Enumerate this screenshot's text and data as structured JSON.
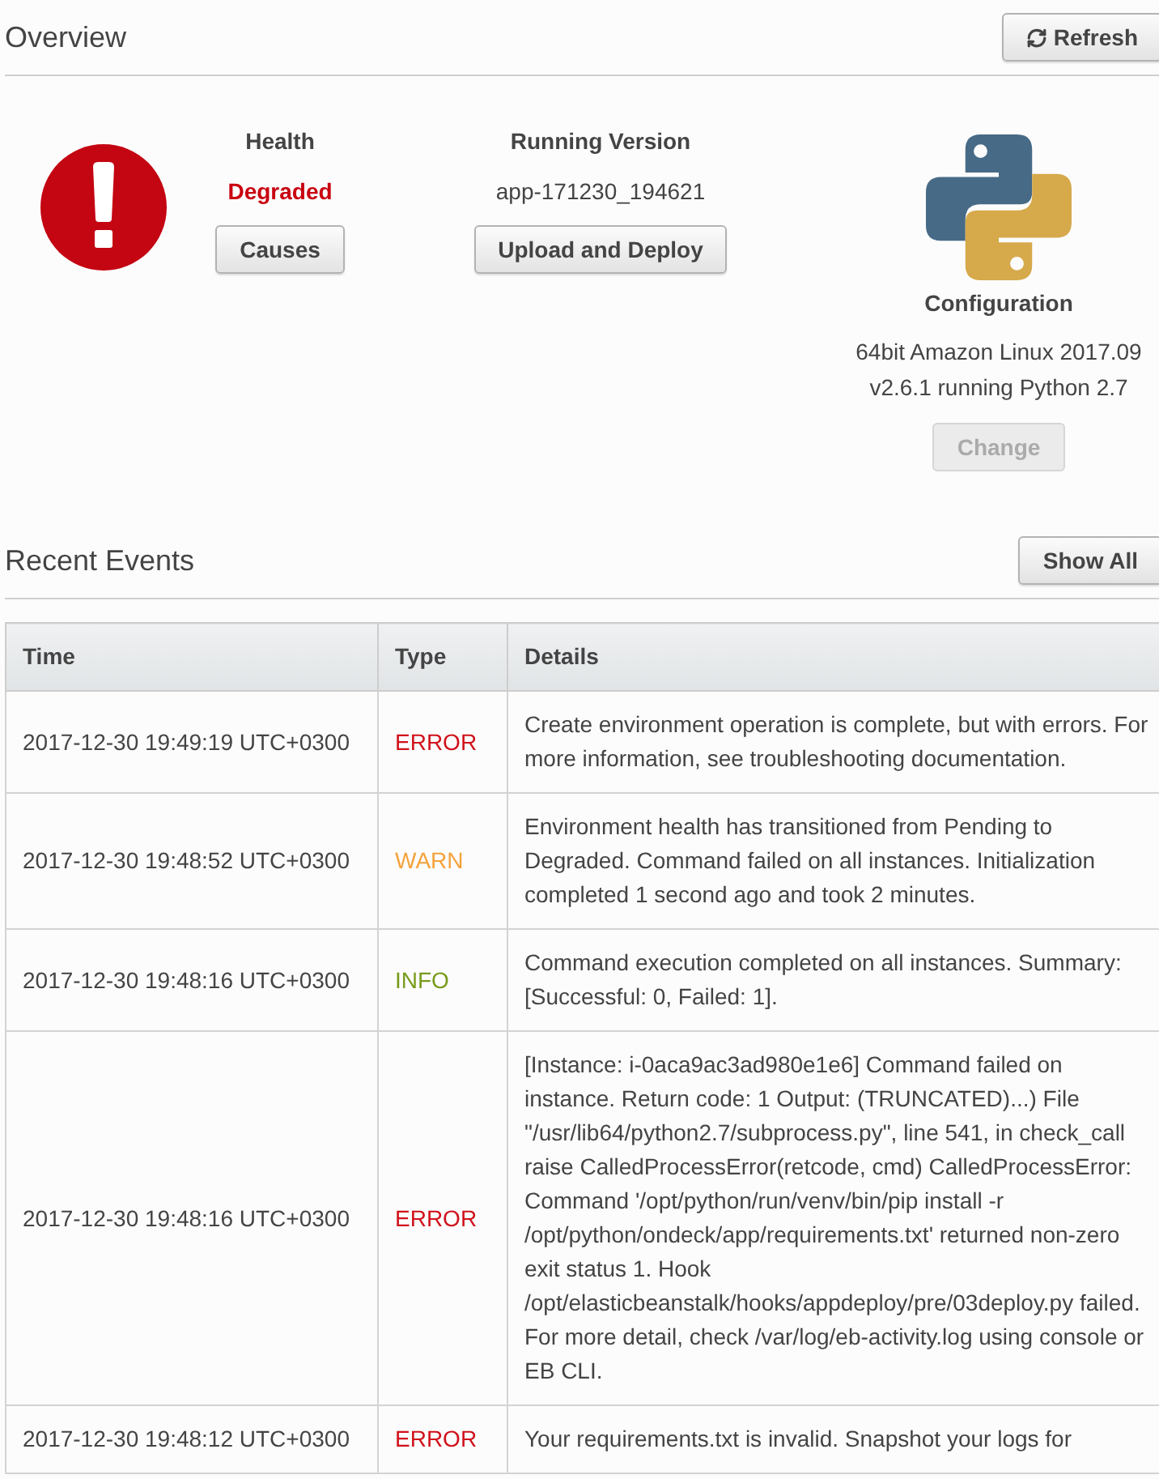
{
  "overview": {
    "title": "Overview",
    "refresh_button": "Refresh",
    "health": {
      "label": "Health",
      "status": "Degraded",
      "causes_button": "Causes"
    },
    "running_version": {
      "label": "Running Version",
      "value": "app-171230_194621",
      "upload_button": "Upload and Deploy"
    },
    "configuration": {
      "label": "Configuration",
      "description": "64bit Amazon Linux 2017.09 v2.6.1 running Python 2.7",
      "change_button": {
        "label": "Change",
        "disabled": true
      }
    }
  },
  "recent_events": {
    "title": "Recent Events",
    "show_all_button": "Show All",
    "columns": [
      "Time",
      "Type",
      "Details"
    ],
    "rows": [
      {
        "time": "2017-12-30 19:49:19 UTC+0300",
        "type": "ERROR",
        "color": "#d0111b",
        "details": "Create environment operation is complete, but with errors. For more information, see troubleshooting documentation."
      },
      {
        "time": "2017-12-30 19:48:52 UTC+0300",
        "type": "WARN",
        "color": "#f5a23a",
        "details": "Environment health has transitioned from Pending to Degraded. Command failed on all instances. Initialization completed 1 second ago and took 2 minutes."
      },
      {
        "time": "2017-12-30 19:48:16 UTC+0300",
        "type": "INFO",
        "color": "#779b1b",
        "details": "Command execution completed on all instances. Summary: [Successful: 0, Failed: 1]."
      },
      {
        "time": "2017-12-30 19:48:16 UTC+0300",
        "type": "ERROR",
        "color": "#d0111b",
        "details": "[Instance: i-0aca9ac3ad980e1e6] Command failed on instance. Return code: 1 Output: (TRUNCATED)...) File \"/usr/lib64/python2.7/subprocess.py\", line 541, in check_call raise CalledProcessError(retcode, cmd) CalledProcessError: Command '/opt/python/run/venv/bin/pip install -r /opt/python/ondeck/app/requirements.txt' returned non-zero exit status 1. Hook /opt/elasticbeanstalk/hooks/appdeploy/pre/03deploy.py failed. For more detail, check /var/log/eb-activity.log using console or EB CLI."
      },
      {
        "time": "2017-12-30 19:48:12 UTC+0300",
        "type": "ERROR",
        "color": "#d0111b",
        "details": "Your requirements.txt is invalid. Snapshot your logs for"
      }
    ]
  }
}
